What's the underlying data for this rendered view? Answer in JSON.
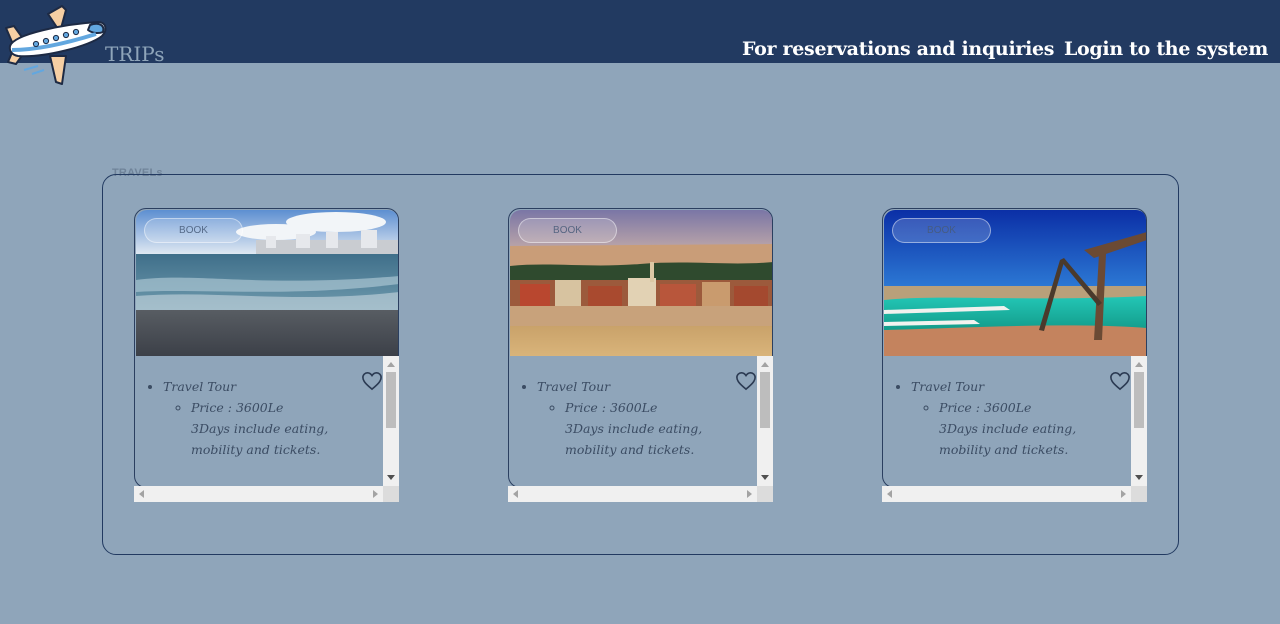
{
  "header": {
    "brand": "TRIPs",
    "nav": {
      "reservations": "For reservations and inquiries",
      "login": "Login to the system"
    }
  },
  "travels": {
    "legend": "TRAVELs",
    "cards": [
      {
        "book_label": "BOOK",
        "title": "Travel Tour",
        "price": "Price : 3600Le",
        "description": "3Days include eating, mobility and tickets.",
        "image": "beach-photo"
      },
      {
        "book_label": "BOOK",
        "title": "Travel Tour",
        "price": "Price : 3600Le",
        "description": "3Days include eating, mobility and tickets.",
        "image": "desert-town-photo"
      },
      {
        "book_label": "BOOK",
        "title": "Travel Tour",
        "price": "Price : 3600Le",
        "description": "3Days include eating, mobility and tickets.",
        "image": "salt-lake-photo"
      }
    ]
  },
  "icons": [
    "airplane-logo-icon",
    "heart-icon"
  ],
  "colors": {
    "header_bg": "#223a61",
    "page_bg": "#8fa5ba",
    "nav_text": "#ffffff",
    "border": "#223a61"
  }
}
